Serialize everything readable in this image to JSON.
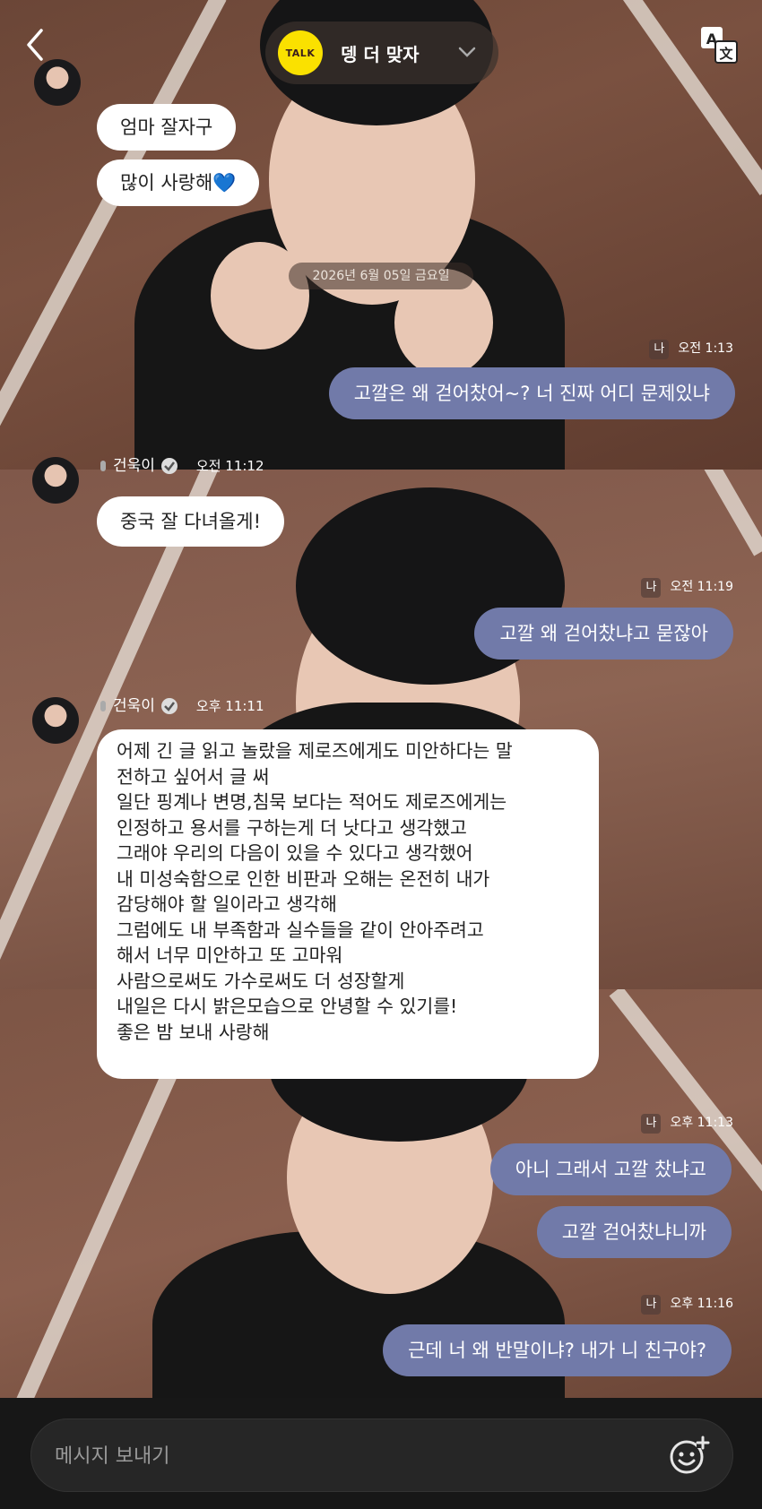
{
  "header": {
    "talk_logo": "TALK",
    "room_title": "뎅 더 맞자",
    "back_icon": "chevron-left-icon",
    "translate_icon": "translate-icon"
  },
  "date_divider": "2026년 6월 05일 금요일",
  "messages": {
    "m1": "엄마 잘자구",
    "m2": "많이 사랑해💙",
    "me_label": "나",
    "t1": "오전 1:13",
    "m3": "고깔은 왜 걷어찼어~? 너 진짜 어디 문제있냐",
    "sender_name": "건욱이",
    "t2": "오전 11:12",
    "m4": "중국 잘 다녀올게!",
    "t3": "오전 11:19",
    "m5": "고깔 왜 걷어찼냐고 묻잖아",
    "t4": "오후 11:11",
    "long": [
      "어제 긴 글 읽고 놀랐을 제로즈에게도 미안하다는 말",
      "전하고 싶어서 글 써",
      "일단 핑계나 변명,침묵 보다는 적어도 제로즈에게는",
      "인정하고 용서를 구하는게 더 낫다고 생각했고",
      "그래야 우리의 다음이 있을 수 있다고 생각했어",
      "내 미성숙함으로 인한 비판과 오해는 온전히 내가",
      "감당해야 할 일이라고 생각해",
      "그럼에도 내 부족함과 실수들을 같이 안아주려고",
      "해서 너무 미안하고 또 고마워",
      "사람으로써도 가수로써도 더 성장할게",
      "내일은 다시 밝은모습으로 안녕할 수 있기를!",
      "좋은 밤 보내 사랑해"
    ],
    "t5": "오후 11:13",
    "m6": "아니 그래서 고깔 찼냐고",
    "m7": "고깔 걷어찼냐니까",
    "t6": "오후 11:16",
    "m8": "근데 너 왜 반말이냐? 내가 니 친구야?"
  },
  "input": {
    "placeholder": "메시지 보내기",
    "emoji_icon": "emoji-add-icon"
  },
  "colors": {
    "my_bubble": "#717aa9",
    "their_bubble": "#ffffff",
    "kakao_yellow": "#fae100",
    "input_bar": "#171717"
  }
}
